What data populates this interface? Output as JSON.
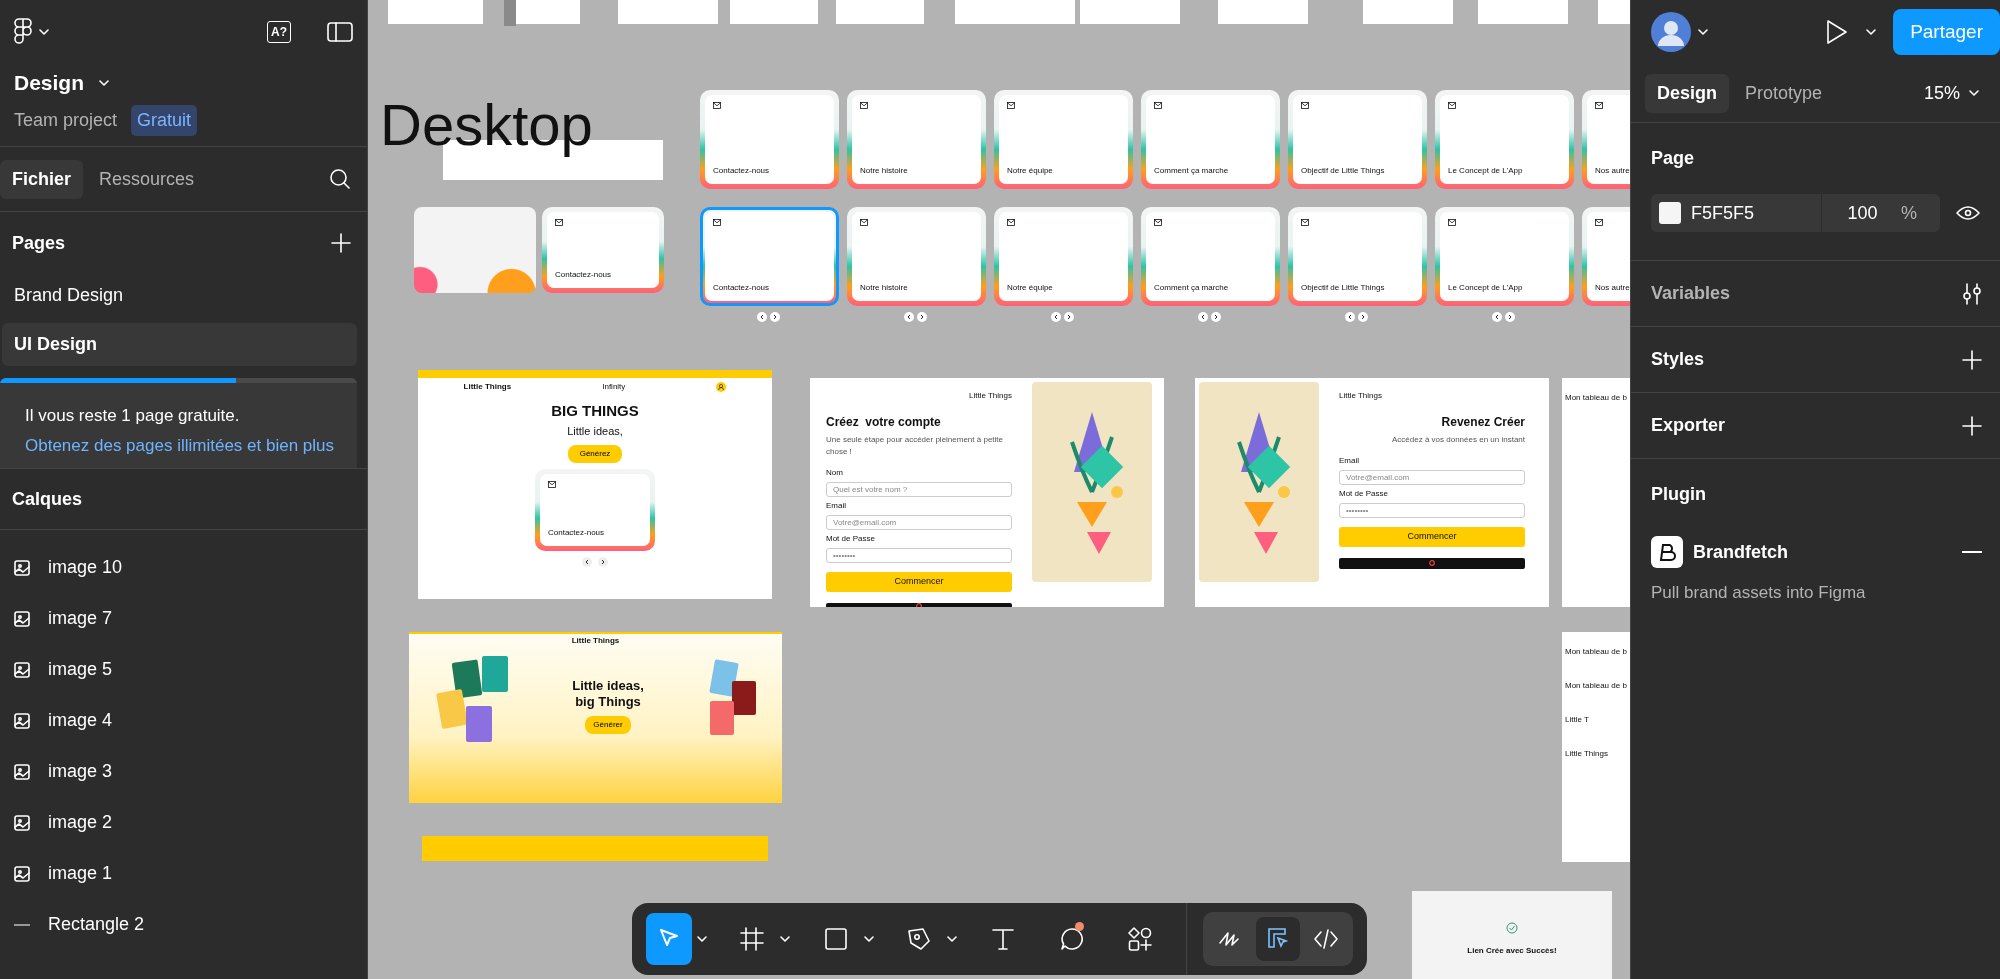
{
  "header": {
    "file_title": "Design",
    "project": "Team project",
    "plan_badge": "Gratuit",
    "help_label": "A?"
  },
  "left_tabs": [
    {
      "label": "Fichier",
      "selected": true
    },
    {
      "label": "Ressources",
      "selected": false
    }
  ],
  "pages": {
    "title": "Pages",
    "items": [
      {
        "label": "Brand Design",
        "selected": false
      },
      {
        "label": "UI Design",
        "selected": true
      }
    ]
  },
  "upsell": {
    "level": 0.66,
    "text": "Il vous reste 1 page gratuite.",
    "link": "Obtenez des pages illimitées et bien plus"
  },
  "layers": {
    "title": "Calques",
    "items": [
      {
        "name": "image 10",
        "kind": "image"
      },
      {
        "name": "image 7",
        "kind": "image"
      },
      {
        "name": "image 5",
        "kind": "image"
      },
      {
        "name": "image 4",
        "kind": "image"
      },
      {
        "name": "image 3",
        "kind": "image"
      },
      {
        "name": "image 2",
        "kind": "image"
      },
      {
        "name": "image 1",
        "kind": "image"
      },
      {
        "name": "Rectangle 2",
        "kind": "rectangle"
      }
    ]
  },
  "canvas": {
    "section_title": "Desktop",
    "card_rows": [
      {
        "cards": [
          {
            "title": "Contactez-nous",
            "selected": false
          },
          {
            "title": "Notre histoire",
            "selected": false
          },
          {
            "title": "Notre équipe",
            "selected": false
          },
          {
            "title": "Comment ça marche",
            "selected": false
          },
          {
            "title": "Objectif de Little Things",
            "selected": false
          },
          {
            "title": "Le Concept de L'App",
            "selected": false
          },
          {
            "title": "Nos autre",
            "selected": false
          }
        ]
      },
      {
        "cards": [
          {
            "title": "Contactez-nous",
            "selected": true
          },
          {
            "title": "Notre histoire",
            "selected": false
          },
          {
            "title": "Notre équipe",
            "selected": false
          },
          {
            "title": "Comment ça marche",
            "selected": false
          },
          {
            "title": "Objectif de Little Things",
            "selected": false
          },
          {
            "title": "Le Concept de L'App",
            "selected": false
          },
          {
            "title": "Nos autre",
            "selected": false
          }
        ]
      }
    ],
    "extra_card": {
      "title": "Contactez-nous"
    },
    "frames": [
      {
        "kind": "landing",
        "brand": "Little Things",
        "nav": "Infinity",
        "headline": "BIG THINGS",
        "tagline": "Little ideas,",
        "button": "Générez",
        "card_title": "Contactez-nous"
      },
      {
        "kind": "signup",
        "brand": "Little Things",
        "title": "Créez  votre compte",
        "subtitle": "Une seule étape pour accéder pleinement à petite chose !",
        "fields": [
          {
            "label": "Nom",
            "placeholder": "Quel est votre nom ?"
          },
          {
            "label": "Email",
            "placeholder": "Votre@email.com"
          },
          {
            "label": "Mot de Passe",
            "placeholder": "••••••••"
          }
        ],
        "button": "Commencer"
      },
      {
        "kind": "login",
        "brand": "Little Things",
        "title": "Revenez Créer",
        "subtitle": "Accédez à vos données en un instant",
        "fields": [
          {
            "label": "Email",
            "placeholder": "Votre@email.com"
          },
          {
            "label": "Mot de Passe",
            "placeholder": "••••••••"
          }
        ],
        "button": "Commencer"
      },
      {
        "kind": "partial",
        "lines": [
          "Mon tableau de b"
        ]
      },
      {
        "kind": "hero",
        "brand": "Little Things",
        "headline": "Little ideas, big Things",
        "button": "Générer"
      },
      {
        "kind": "footer"
      },
      {
        "kind": "partial",
        "lines": [
          "Mon tableau de b",
          "Mon tableau de b",
          "Little T",
          "Little Things"
        ]
      },
      {
        "kind": "success",
        "title": "Lien Crée avec Succès!"
      }
    ]
  },
  "toolbar": {
    "tools": [
      {
        "kind": "move",
        "selected": true,
        "has_menu": true
      },
      {
        "kind": "frame",
        "selected": false,
        "has_menu": true
      },
      {
        "kind": "shape",
        "selected": false,
        "has_menu": true
      },
      {
        "kind": "pen",
        "selected": false,
        "has_menu": true
      },
      {
        "kind": "text",
        "selected": false,
        "has_menu": false
      },
      {
        "kind": "comment",
        "selected": false,
        "has_menu": false,
        "notification": true
      },
      {
        "kind": "actions",
        "selected": false,
        "has_menu": false
      }
    ],
    "modes": [
      {
        "kind": "draw",
        "selected": false
      },
      {
        "kind": "design",
        "selected": true
      },
      {
        "kind": "dev",
        "selected": false
      }
    ]
  },
  "right_panel": {
    "share_button": "Partager",
    "tabs": [
      {
        "label": "Design",
        "selected": true
      },
      {
        "label": "Prototype",
        "selected": false
      }
    ],
    "zoom": "15%",
    "page": {
      "title": "Page",
      "color": "F5F5F5",
      "opacity": "100",
      "unit": "%"
    },
    "sections": [
      {
        "title": "Variables",
        "kind": "variables"
      },
      {
        "title": "Styles",
        "kind": "add"
      },
      {
        "title": "Exporter",
        "kind": "add"
      }
    ],
    "plugin": {
      "title": "Plugin",
      "name": "Brandfetch",
      "description": "Pull brand assets into Figma"
    }
  }
}
